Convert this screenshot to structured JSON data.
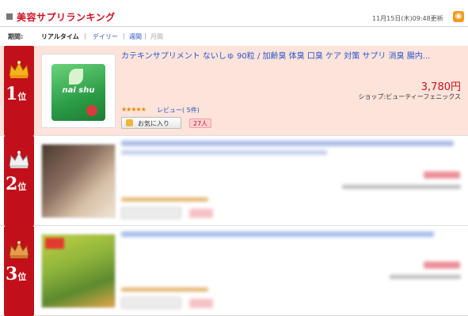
{
  "header": {
    "title": "美容サプリランキング",
    "updated": "11月15日(木)09:48更新",
    "rss_icon": "rss-icon",
    "accent_color": "#cc1122"
  },
  "period": {
    "label": "期間:",
    "realtime": "リアルタイム",
    "sep": "|",
    "daily": "デイリー",
    "weekly": "週間",
    "monthly": "月間"
  },
  "ranking": [
    {
      "rank": "1",
      "rank_unit": "位",
      "title": "カテキンサプリメント ないしゅ 90粒 / 加齢臭 体臭 口臭 ケア 対策 サプリ 消臭 腸内...",
      "price": "3,780円",
      "shop": "ショップ:ビューティーフェニックス",
      "stars": "★★★★★",
      "review": "レビュー( 5件)",
      "fav_label": "お気に入り",
      "fav_count": "27人",
      "package_text": "nai shu"
    },
    {
      "rank": "2",
      "rank_unit": "位"
    },
    {
      "rank": "3",
      "rank_unit": "位"
    }
  ]
}
